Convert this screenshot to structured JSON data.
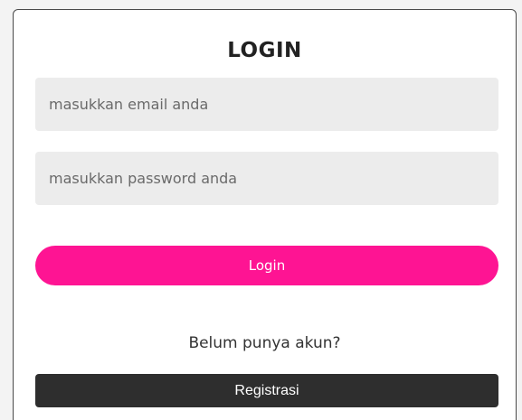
{
  "login_form": {
    "title": "LOGIN",
    "email_placeholder": "masukkan email anda",
    "email_value": "",
    "password_placeholder": "masukkan password anda",
    "password_value": "",
    "login_button_label": "Login",
    "no_account_text": "Belum punya akun?",
    "register_button_label": "Registrasi"
  },
  "colors": {
    "accent": "#fe1493",
    "input_background": "#ececec",
    "register_button": "#2e2e2e"
  }
}
